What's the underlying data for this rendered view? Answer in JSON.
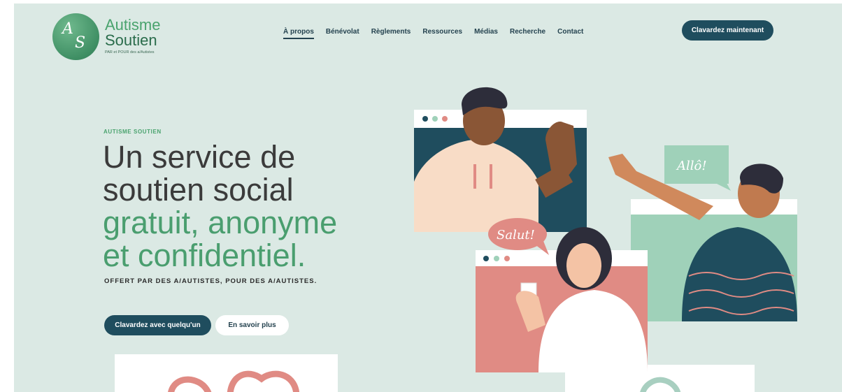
{
  "logo": {
    "monogram_a": "A",
    "monogram_s": "S",
    "line1": "Autisme",
    "line2": "Soutien",
    "tagline": "PAR et POUR des a/Autistes"
  },
  "nav": {
    "items": [
      {
        "label": "À propos",
        "active": true
      },
      {
        "label": "Bénévolat",
        "active": false
      },
      {
        "label": "Règlements",
        "active": false
      },
      {
        "label": "Ressources",
        "active": false
      },
      {
        "label": "Médias",
        "active": false
      },
      {
        "label": "Recherche",
        "active": false
      },
      {
        "label": "Contact",
        "active": false
      }
    ],
    "cta_label": "Clavardez maintenant"
  },
  "hero": {
    "eyebrow": "AUTISME SOUTIEN",
    "headline_line1": "Un service de",
    "headline_line2": "soutien social",
    "headline_line3": "gratuit, anonyme",
    "headline_line4": "et confidentiel.",
    "subtitle": "OFFERT PAR DES A/AUTISTES, POUR DES A/AUTISTES.",
    "primary_button": "Clavardez avec quelqu'un",
    "secondary_button": "En savoir plus"
  },
  "illustration": {
    "bubble_salut": "Salut!",
    "bubble_allo": "Allô!"
  },
  "colors": {
    "background": "#dbe9e4",
    "brand_green": "#4a9e6f",
    "dark_teal": "#1f4d5e",
    "coral": "#e08b84",
    "mint": "#9fd1b9"
  }
}
